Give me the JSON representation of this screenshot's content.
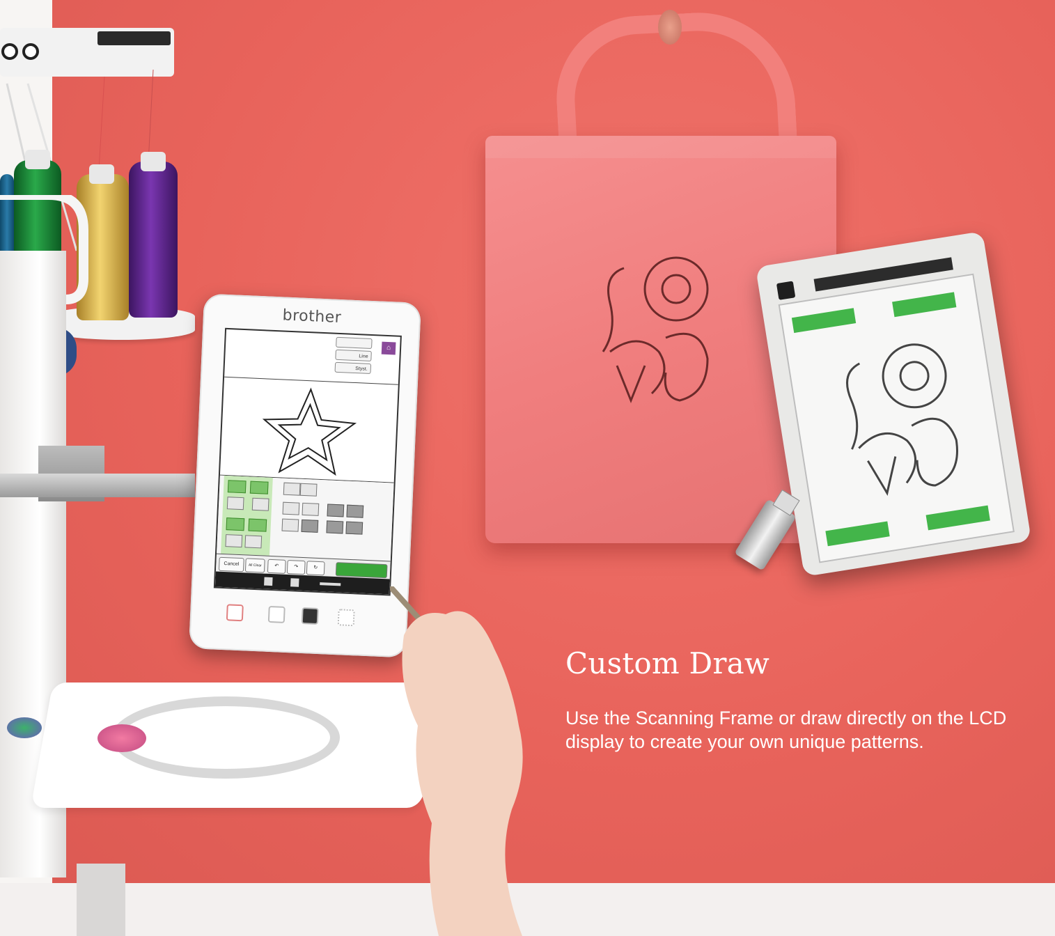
{
  "feature": {
    "heading": "Custom Draw",
    "description": "Use the Scanning Frame or draw directly on the LCD display to create your own unique patterns."
  },
  "tablet": {
    "brand": "brother",
    "screen_buttons": [
      "Line",
      "Styst."
    ],
    "action_buttons": [
      "Cancel",
      "All Clear"
    ]
  },
  "colors": {
    "background": "#e8635b",
    "bag": "#f07e7e",
    "text": "#ffffff",
    "accent_green": "#43b54a",
    "screen_purple": "#8a4a9a"
  },
  "icons": [
    "home-icon",
    "undo-icon",
    "pen-icon",
    "eraser-icon",
    "zoom-in-icon",
    "zoom-out-icon",
    "scissors-icon"
  ]
}
